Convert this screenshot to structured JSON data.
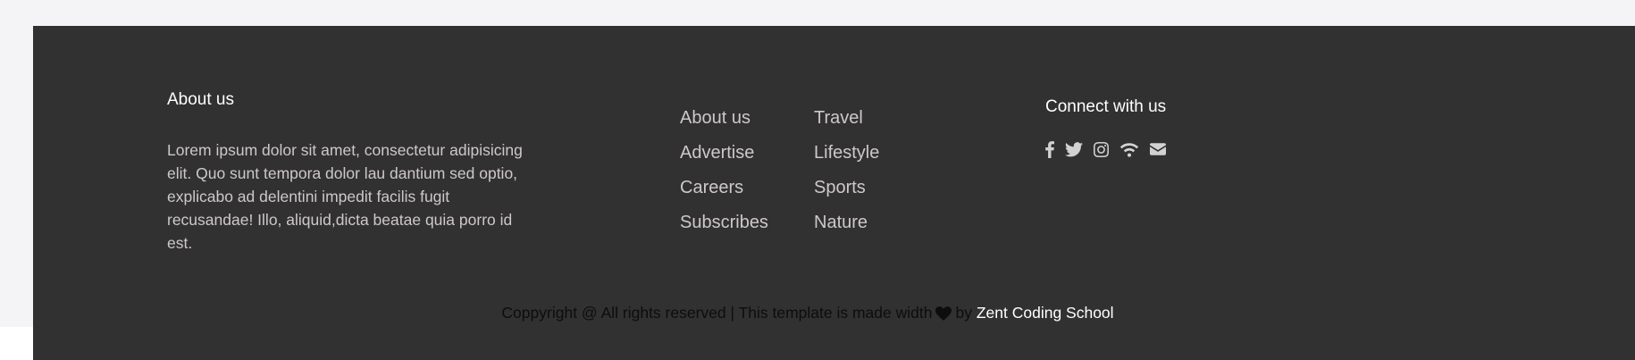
{
  "about": {
    "heading": "About us",
    "text": "Lorem ipsum dolor sit amet, consectetur adipisicing elit. Quo sunt tempora dolor lau dantium sed optio, explicabo ad delentini impedit facilis fugit recusandae! Illo, aliquid,dicta beatae quia porro id est."
  },
  "links": {
    "col1": [
      "About us",
      "Advertise",
      "Careers",
      "Subscribes"
    ],
    "col2": [
      "Travel",
      "Lifestyle",
      "Sports",
      "Nature"
    ]
  },
  "connect": {
    "heading": "Connect with us",
    "icons": [
      "facebook-icon",
      "twitter-icon",
      "instagram-icon",
      "rss-wifi-icon",
      "envelope-icon"
    ]
  },
  "copyright": {
    "prefix": "Coppyright @ All rights reserved | This template is made width",
    "by": "by",
    "author": "Zent Coding School",
    "heart_icon": "heart-icon"
  },
  "colors": {
    "page_background": "#f4f4f6",
    "footer_background": "#313131",
    "heading": "#ffffff",
    "body_text": "#cfc8c8",
    "copyright_text": "#0d0d0d",
    "author_link": "#ffffff"
  }
}
